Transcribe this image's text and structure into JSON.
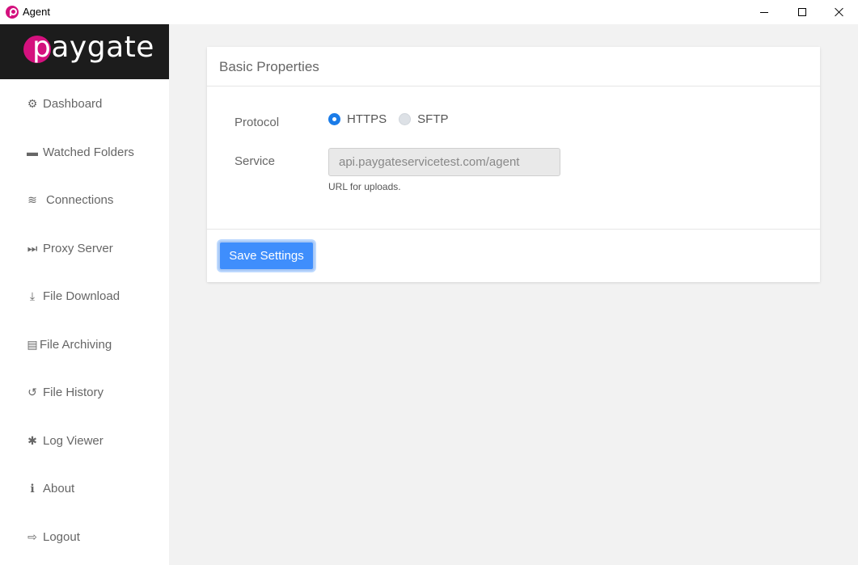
{
  "window": {
    "title": "Agent",
    "minimize_icon": "minimize-icon",
    "maximize_icon": "maximize-icon",
    "close_icon": "close-icon"
  },
  "brand": {
    "name": "paygate",
    "accent": "#d4117e"
  },
  "sidebar": {
    "items": [
      {
        "label": "Dashboard",
        "icon": "gear-icon",
        "glyph": "⚙"
      },
      {
        "label": "Watched Folders",
        "icon": "folder-icon",
        "glyph": "▬"
      },
      {
        "label": "Connections",
        "icon": "wifi-icon",
        "glyph": "≋"
      },
      {
        "label": "Proxy Server",
        "icon": "fast-forward-icon",
        "glyph": "⏭"
      },
      {
        "label": "File Download",
        "icon": "download-icon",
        "glyph": "⤓"
      },
      {
        "label": "File Archiving",
        "icon": "archive-file-icon",
        "glyph": "▤"
      },
      {
        "label": "File History",
        "icon": "history-icon",
        "glyph": "↺"
      },
      {
        "label": "Log Viewer",
        "icon": "bug-icon",
        "glyph": "✱"
      },
      {
        "label": "About",
        "icon": "info-icon",
        "glyph": "ℹ"
      },
      {
        "label": "Logout",
        "icon": "sign-out-icon",
        "glyph": "⇨"
      }
    ]
  },
  "panel": {
    "title": "Basic Properties",
    "protocol_label": "Protocol",
    "protocol_options": [
      {
        "label": "HTTPS",
        "selected": true
      },
      {
        "label": "SFTP",
        "selected": false
      }
    ],
    "service_label": "Service",
    "service_value": "api.paygateservicetest.com/agent",
    "service_help": "URL for uploads.",
    "save_label": "Save Settings",
    "accent": "#3f8efc"
  }
}
